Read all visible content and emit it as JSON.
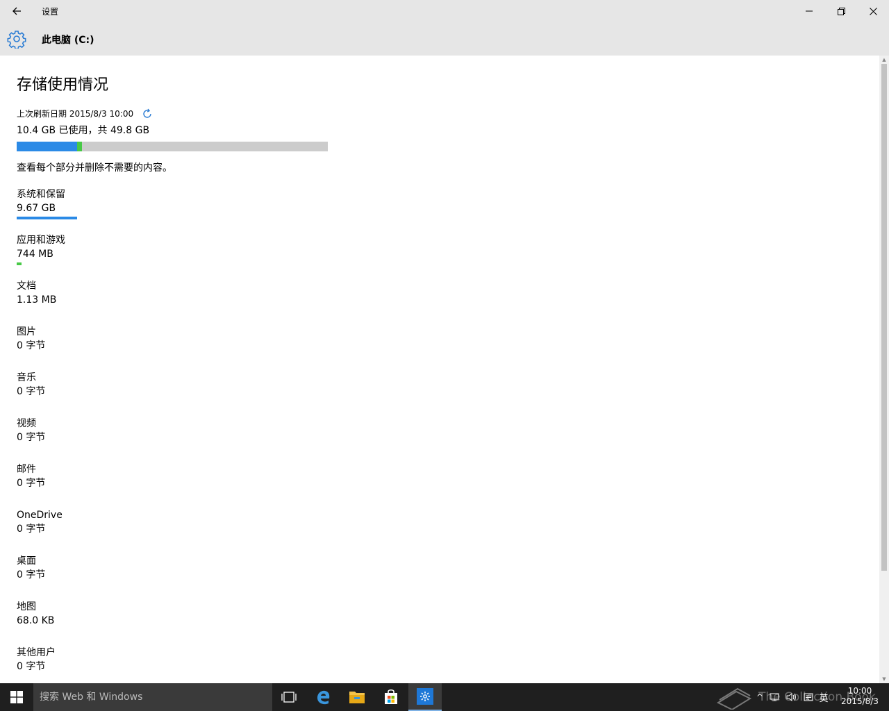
{
  "titlebar": {
    "title": "设置"
  },
  "header": {
    "title": "此电脑 (C:)"
  },
  "storage": {
    "title": "存储使用情况",
    "refresh_text": "上次刷新日期 2015/8/3 10:00",
    "usage_text": "10.4 GB 已使用，共 49.8 GB",
    "instruction": "查看每个部分并删除不需要的内容。",
    "usage_fraction_system": 0.194,
    "usage_fraction_apps": 0.015,
    "colors": {
      "system": "#2b8ae6",
      "apps": "#48c947",
      "free": "#cccccc"
    }
  },
  "categories": [
    {
      "name": "系统和保留",
      "size": "9.67 GB",
      "fraction": 0.194,
      "color": "#2b8ae6"
    },
    {
      "name": "应用和游戏",
      "size": "744 MB",
      "fraction": 0.015,
      "color": "#48c947"
    },
    {
      "name": "文档",
      "size": "1.13 MB"
    },
    {
      "name": "图片",
      "size": "0 字节"
    },
    {
      "name": "音乐",
      "size": "0 字节"
    },
    {
      "name": "视频",
      "size": "0 字节"
    },
    {
      "name": "邮件",
      "size": "0 字节"
    },
    {
      "name": "OneDrive",
      "size": "0 字节"
    },
    {
      "name": "桌面",
      "size": "0 字节"
    },
    {
      "name": "地图",
      "size": "68.0 KB"
    },
    {
      "name": "其他用户",
      "size": "0 字节"
    }
  ],
  "taskbar": {
    "search_placeholder": "搜索 Web 和 Windows",
    "input_language": "英",
    "clock_time": "10:00",
    "clock_date": "2015/8/3",
    "watermark": "The Collection Book"
  }
}
